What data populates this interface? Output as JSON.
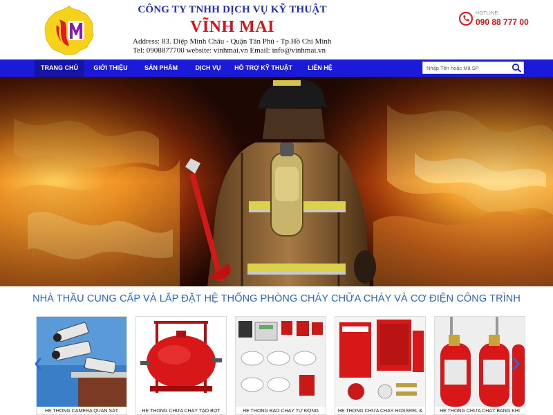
{
  "header": {
    "company_line1": "CÔNG TY TNHH DỊCH VỤ KỸ THUẬT",
    "company_line2": "VĨNH MAI",
    "address": "Address: 83. Diệp Minh Châu - Quận Tân Phú - Tp.Hồ Chí Minh",
    "contact": "Tel: 0908877700   website: vinhmai.vn  Email: info@vinhmai.vn",
    "hotline_label": "HOTLINE:",
    "hotline_number": "090 88 777 00",
    "logo_icon": "vm-logo-icon",
    "hotline_icon": "phone-icon"
  },
  "nav": {
    "items": [
      {
        "label": "TRANG CHỦ"
      },
      {
        "label": "GIỚI THIỆU"
      },
      {
        "label": "SẢN PHẨM"
      },
      {
        "label": "DỊCH VỤ"
      },
      {
        "label": "HỖ TRỢ KỸ THUẬT"
      },
      {
        "label": "LIÊN HỆ"
      }
    ],
    "active_index": 0,
    "search_placeholder": "Nhập Tên hoặc Mã SP",
    "search_icon": "search-icon"
  },
  "hero": {
    "image": "firefighter-in-flames"
  },
  "headline": "NHÀ THẦU CUNG CẤP VÀ LẮP ĐẶT HỆ THỐNG PHÒNG CHÁY CHỮA CHÁY VÀ CƠ ĐIỆN CÔNG TRÌNH",
  "products": {
    "items": [
      {
        "caption": "HỆ THỐNG CAMERA QUAN SÁT"
      },
      {
        "caption": "HỆ THỐNG CHỮA CHÁY TẠO BỌT"
      },
      {
        "caption": "HỆ THỐNG BÁO CHÁY TỰ ĐỘNG"
      },
      {
        "caption": "HỆ THỐNG CHỮA CHÁY HOSSREL &"
      },
      {
        "caption": "HỆ THỐNG CHỮA CHÁY BẰNG KHÍ"
      }
    ],
    "prev_icon": "chevron-left-icon",
    "next_icon": "chevron-right-icon"
  },
  "colors": {
    "nav_blue": "#1a1ad8",
    "nav_active": "#1414a8",
    "brand_red": "#d8121a",
    "title_blue": "#1f2db8",
    "headline_blue": "#2a64c4"
  }
}
